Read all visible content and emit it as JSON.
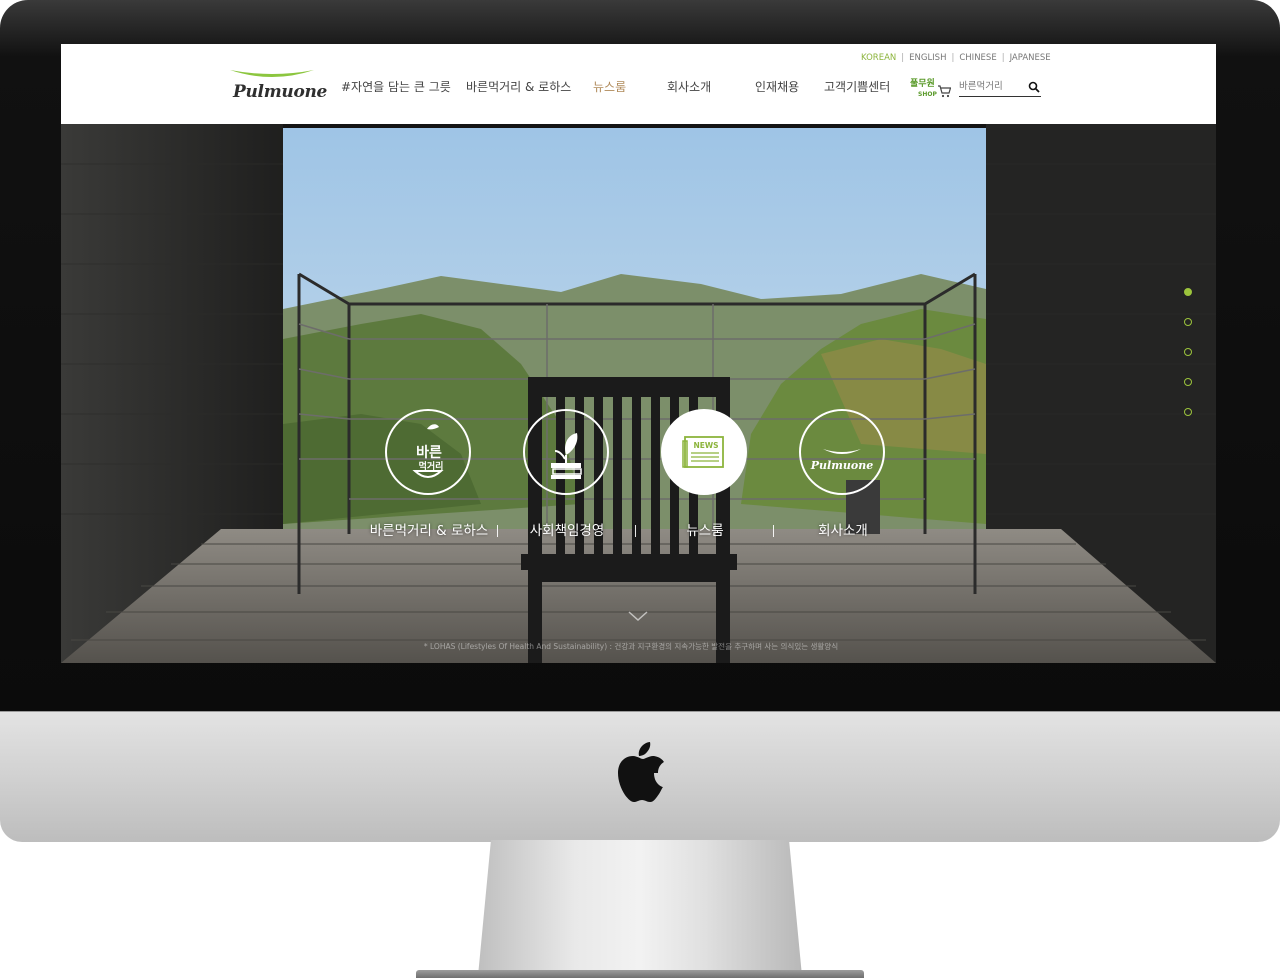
{
  "header": {
    "logo_text": "Pulmuone",
    "languages": [
      {
        "label": "KOREAN",
        "active": true
      },
      {
        "label": "ENGLISH",
        "active": false
      },
      {
        "label": "CHINESE",
        "active": false
      },
      {
        "label": "JAPANESE",
        "active": false
      }
    ],
    "lang_separator": "|",
    "nav": [
      {
        "label": "#자연을 담는 큰 그릇",
        "active": false
      },
      {
        "label": "바른먹거리 & 로하스",
        "active": false
      },
      {
        "label": "뉴스룸",
        "active": true
      },
      {
        "label": "회사소개",
        "active": false
      },
      {
        "label": "인재채용",
        "active": false
      },
      {
        "label": "고객기쁨센터",
        "active": false
      }
    ],
    "shop": {
      "label": "풀무원",
      "sub": "SHOP",
      "icon": "cart-icon"
    },
    "search": {
      "placeholder": "바른먹거리",
      "icon": "search-icon"
    }
  },
  "hero": {
    "circles": [
      {
        "label": "바른먹거리 & 로하스",
        "icon": "bareun-meokgeori-icon",
        "icon_text_top": "바른",
        "icon_text_bottom": "먹거리",
        "active": false
      },
      {
        "label": "사회책임경영",
        "icon": "leaf-books-icon",
        "active": false
      },
      {
        "label": "뉴스룸",
        "icon": "newspaper-icon",
        "icon_text": "NEWS",
        "active": true
      },
      {
        "label": "회사소개",
        "icon": "pulmuone-logo-icon",
        "icon_text": "Pulmuone",
        "active": false
      }
    ],
    "pagination": [
      true,
      false,
      false,
      false,
      false
    ],
    "scroll_icon": "chevron-down-icon",
    "footnote": "* LOHAS (Lifestyles Of Health And Sustainability) : 건강과 지구환경의 지속가능한 발전을 추구하며 사는 의식있는 생활양식"
  },
  "colors": {
    "accent_green": "#9cc43c",
    "active_nav": "#b08a5a"
  }
}
